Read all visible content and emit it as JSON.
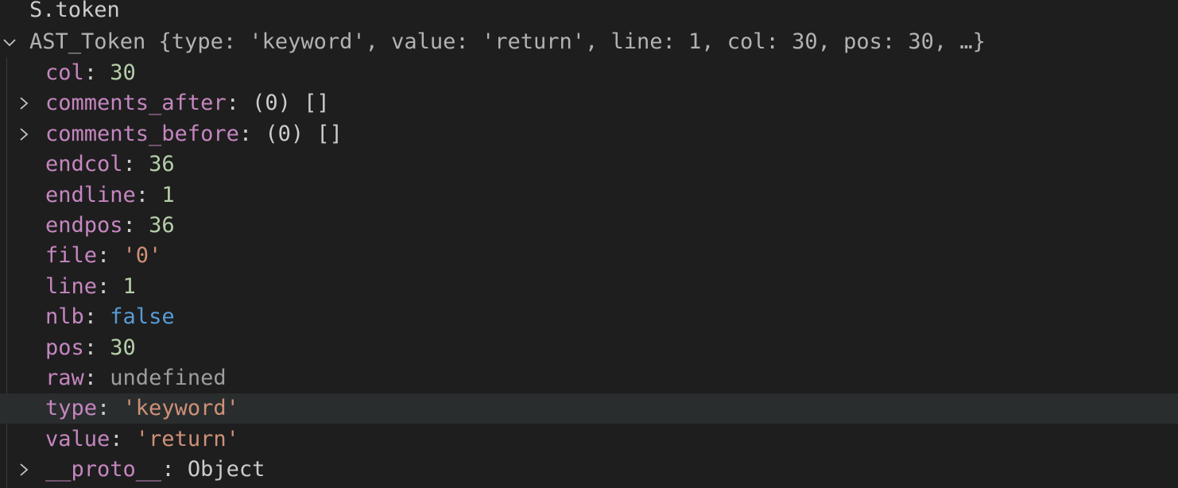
{
  "watch_expression": "S.token",
  "root": {
    "label": "AST_Token {type: 'keyword', value: 'return', line: 1, col: 30, pos: 30, …}",
    "expanded": true
  },
  "properties": [
    {
      "key": "col",
      "value": "30",
      "kind": "number",
      "expandable": false
    },
    {
      "key": "comments_after",
      "value": "(0) []",
      "kind": "object",
      "expandable": true
    },
    {
      "key": "comments_before",
      "value": "(0) []",
      "kind": "object",
      "expandable": true
    },
    {
      "key": "endcol",
      "value": "36",
      "kind": "number",
      "expandable": false
    },
    {
      "key": "endline",
      "value": "1",
      "kind": "number",
      "expandable": false
    },
    {
      "key": "endpos",
      "value": "36",
      "kind": "number",
      "expandable": false
    },
    {
      "key": "file",
      "value": "'0'",
      "kind": "string",
      "expandable": false
    },
    {
      "key": "line",
      "value": "1",
      "kind": "number",
      "expandable": false
    },
    {
      "key": "nlb",
      "value": "false",
      "kind": "boolean",
      "expandable": false
    },
    {
      "key": "pos",
      "value": "30",
      "kind": "number",
      "expandable": false
    },
    {
      "key": "raw",
      "value": "undefined",
      "kind": "undefined",
      "expandable": false
    },
    {
      "key": "type",
      "value": "'keyword'",
      "kind": "string",
      "expandable": false,
      "selected": true
    },
    {
      "key": "value",
      "value": "'return'",
      "kind": "string",
      "expandable": false
    },
    {
      "key": "__proto__",
      "value": "Object",
      "kind": "object",
      "expandable": true
    }
  ],
  "colors": {
    "background": "#1e1e1e",
    "hover_row": "#2a2d2e",
    "key": "#c586c0",
    "number": "#b5cea8",
    "string": "#ce9178",
    "boolean": "#569cd6",
    "undefined": "#9d9d9d",
    "text": "#cccccc"
  },
  "icons": {
    "expanded": "chevron-down-icon",
    "collapsed": "chevron-right-icon"
  }
}
